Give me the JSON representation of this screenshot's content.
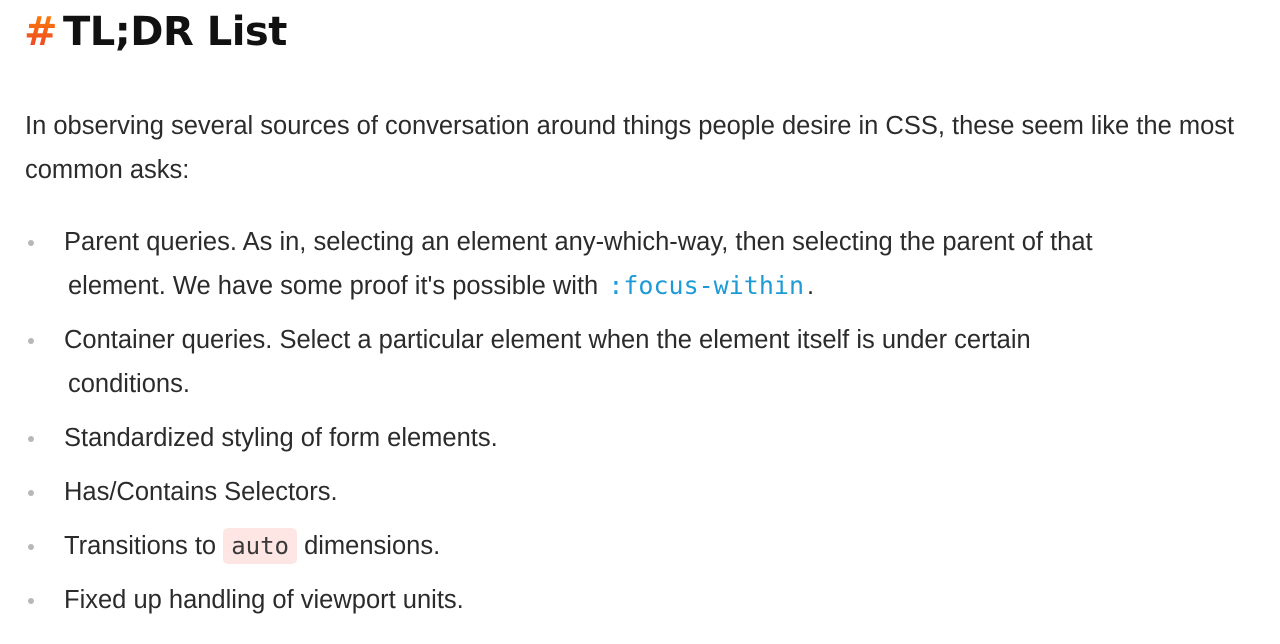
{
  "heading": {
    "anchor": "#",
    "title": "TL;DR List"
  },
  "intro": {
    "line1": "In observing several sources of conversation around things people desire in CSS, these seem like",
    "line2": "the most common asks:"
  },
  "items": [
    {
      "line1": "Parent queries. As in, selecting an element any-which-way, then selecting the parent of that",
      "line2_before": "element. We have some proof it's possible with ",
      "code": ":focus-within",
      "line2_after": "."
    },
    {
      "line1": "Container queries. Select a particular element when the element itself is under certain",
      "line2": "conditions."
    },
    {
      "text": "Standardized styling of form elements."
    },
    {
      "text": "Has/Contains Selectors."
    },
    {
      "before": "Transitions to ",
      "code": "auto",
      "after": " dimensions."
    },
    {
      "text": "Fixed up handling of viewport units."
    }
  ],
  "colors": {
    "anchor_gradient_start": "#ff8a00",
    "anchor_gradient_end": "#e8362f",
    "inline_code": "#1e9bd7",
    "code_pill_bg": "#fde6e3",
    "bullet": "#b8b8b8"
  }
}
